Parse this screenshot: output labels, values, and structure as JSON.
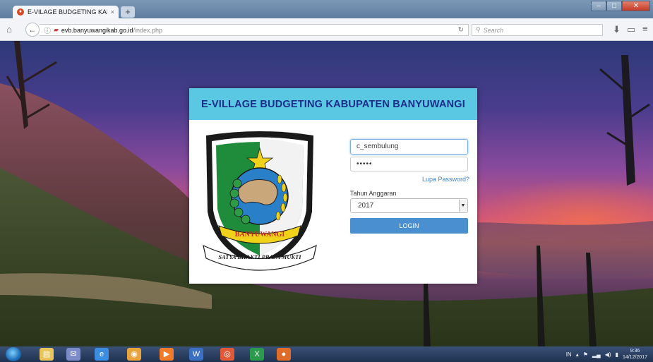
{
  "browser": {
    "tab_title": "E-VILAGE BUDGETING KAB...",
    "tab_close": "×",
    "new_tab": "+",
    "url_host": "evb.banyuwangikab.go.id",
    "url_path": "/index.php",
    "search_placeholder": "Search"
  },
  "login": {
    "title": "E-VILLAGE BUDGETING KABUPATEN BANYUWANGI",
    "username_value": "c_sembulung",
    "password_value": "•••••",
    "forgot_link": "Lupa Password?",
    "year_label": "Tahun Anggaran",
    "year_value": "2017",
    "login_button": "LOGIN"
  },
  "logo": {
    "ribbon_text": "BANYUWANGI",
    "motto": "SATYA BHAKTI PRAJA MUKTI"
  },
  "taskbar": {
    "lang": "IN",
    "time": "9:36",
    "date": "14/12/2017"
  },
  "icons": [
    "home-icon",
    "back-icon",
    "info-icon",
    "lock-icon",
    "reload-icon",
    "search-icon",
    "download-icon",
    "library-icon",
    "menu-icon",
    "windows-start-icon"
  ]
}
